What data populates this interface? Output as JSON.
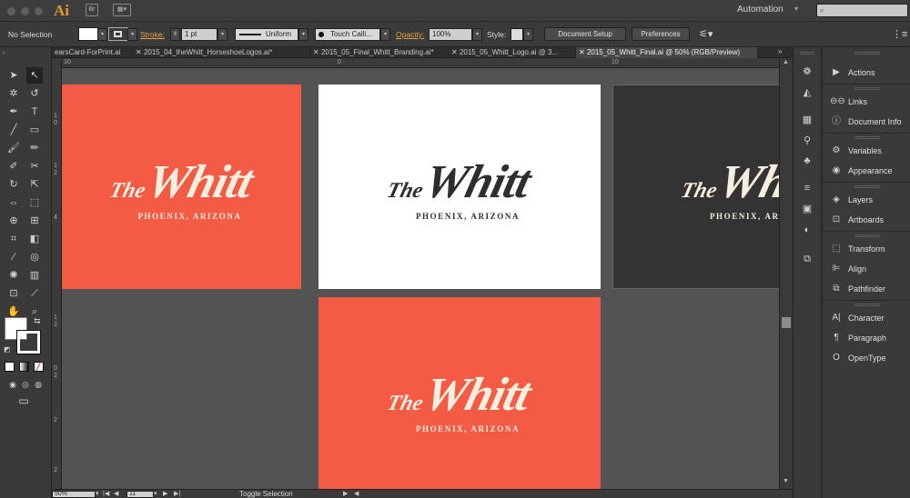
{
  "app": {
    "logo": "Ai",
    "bridge_label": "Br",
    "workspace": "Automation",
    "search_placeholder": ""
  },
  "control_bar": {
    "selection_label": "No Selection",
    "stroke_label": "Stroke:",
    "stroke_weight": "1 pt",
    "stroke_profile": "Uniform",
    "brush_name": "Touch Calli...",
    "opacity_label": "Opacity:",
    "opacity_value": "100%",
    "style_label": "Style:",
    "document_setup": "Document Setup",
    "preferences": "Preferences"
  },
  "tabs": [
    {
      "label": "earsCard-ForPrint.ai",
      "active": false
    },
    {
      "label": "2015_04_theWhitt_HorseshoeLogos.ai*",
      "active": false
    },
    {
      "label": "2015_05_Final_Whitt_Branding.ai*",
      "active": false
    },
    {
      "label": "2015_05_Whitt_Logo.ai @ 3...",
      "active": false
    },
    {
      "label": "2015_05_Whitt_Final.ai @ 50% (RGB/Preview)",
      "active": true
    }
  ],
  "artboards": [
    {
      "the": "The",
      "name": "Whitt",
      "sub": "PHOENIX, ARIZONA",
      "bg": "#f35b45",
      "fg": "#f6eede"
    },
    {
      "the": "The",
      "name": "Whitt",
      "sub": "PHOENIX, ARIZONA",
      "bg": "#ffffff",
      "fg": "#2e2e2e"
    },
    {
      "the": "The",
      "name": "Whitt",
      "sub": "PHOENIX, ARIZONA",
      "bg": "#333333",
      "fg": "#f6eede"
    },
    {
      "the": "The",
      "name": "Whitt",
      "sub": "PHOENIX, ARIZONA",
      "bg": "#f35b45",
      "fg": "#f6eede"
    }
  ],
  "panels": [
    {
      "label": "Actions",
      "icon": "play-icon"
    },
    {
      "label": "Links",
      "icon": "links-icon"
    },
    {
      "label": "Document Info",
      "icon": "document-info-icon"
    },
    {
      "label": "Variables",
      "icon": "variables-icon"
    },
    {
      "label": "Appearance",
      "icon": "appearance-icon"
    },
    {
      "label": "Layers",
      "icon": "layers-icon"
    },
    {
      "label": "Artboards",
      "icon": "artboards-icon"
    },
    {
      "label": "Transform",
      "icon": "transform-icon"
    },
    {
      "label": "Align",
      "icon": "align-icon"
    },
    {
      "label": "Pathfinder",
      "icon": "pathfinder-icon"
    },
    {
      "label": "Character",
      "icon": "character-icon"
    },
    {
      "label": "Paragraph",
      "icon": "paragraph-icon"
    },
    {
      "label": "OpenType",
      "icon": "opentype-icon"
    }
  ],
  "rulers": {
    "top": [
      "10",
      "0",
      "10"
    ],
    "left": [
      "1",
      "0",
      "1",
      "2",
      "4",
      "1",
      "2",
      "0",
      "2",
      "2",
      "2"
    ]
  },
  "status_bar": {
    "zoom": "50%",
    "artboard_number": "11",
    "status_text": "Toggle Selection"
  },
  "colors": {
    "accent_orange": "#e49a34",
    "coral": "#f35b45",
    "cream": "#f6eede",
    "charcoal": "#333333"
  }
}
